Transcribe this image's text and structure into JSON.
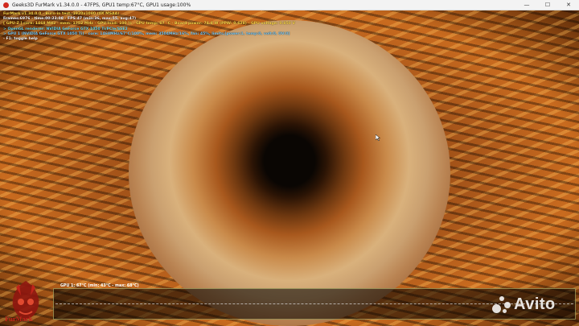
{
  "window": {
    "title": "Geeks3D FurMark v1.34.0.0 - 47FPS, GPU1 temp:67°C, GPU1 usage:100%",
    "minimize": "—",
    "maximize": "☐",
    "close": "✕"
  },
  "overlay": {
    "line1": "FurMark v1.34.0.0 - Burn-in test, 1920x1080 (0X MSAA)",
    "line2": "Frames:6976 - time:00:23:08 - FPS:47 (min:36, max:55, avg:47)",
    "line3": "[ GPU-Z ] core: 1468 MHz - mem: 1752 MHz - GPU load: 100 % - GPU temp: 67 °C - Board power: 74.8 W (PPW: 0.628) - GPU voltage: 0.850 V",
    "line4": "> OpenGL renderer: NVIDIA GeForce GTX 1050 Ti/PCIe/SSE2",
    "line5": "> GPU 1 (NVIDIA GeForce GTX 1050 Ti) - core: 1468MHz/67°C/100%, mem: 3504MHz/16%, fan: 45%, limits:[power:1, temp:0, volt:0, OV:0]",
    "line6": "- F1: toggle help"
  },
  "graph": {
    "label": "GPU 1: 67°C (min: 43°C - max: 68°C)"
  },
  "logo": {
    "text": "FurMark"
  },
  "watermark": {
    "text": "Avito"
  }
}
